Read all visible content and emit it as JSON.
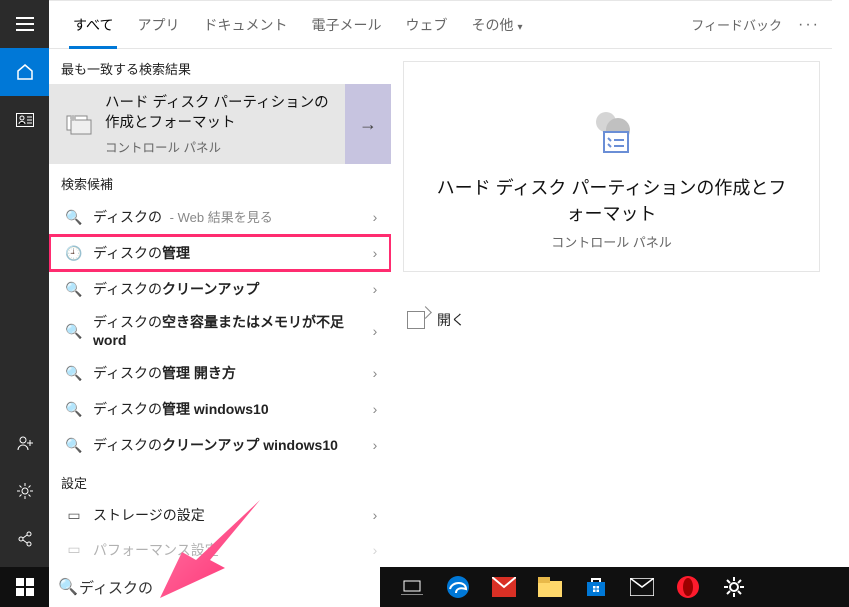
{
  "colors": {
    "accent": "#0078d7",
    "highlight": "#ff2c70"
  },
  "rail": {
    "items": [
      "menu",
      "home",
      "contacts"
    ],
    "bottom_items": [
      "person",
      "gear",
      "share"
    ]
  },
  "tabs": {
    "items": [
      {
        "label": "すべて",
        "active": true
      },
      {
        "label": "アプリ"
      },
      {
        "label": "ドキュメント"
      },
      {
        "label": "電子メール"
      },
      {
        "label": "ウェブ"
      },
      {
        "label": "その他",
        "dropdown": true
      }
    ],
    "feedback": "フィードバック"
  },
  "sections": {
    "best_match_header": "最も一致する検索結果",
    "suggestions_header": "検索候補",
    "settings_header": "設定"
  },
  "best_match": {
    "title": "ハード ディスク パーティションの作成とフォーマット",
    "subtitle": "コントロール パネル"
  },
  "suggestions": [
    {
      "icon": "search",
      "pre": "ディスクの",
      "bold": "",
      "hint": " - Web 結果を見る"
    },
    {
      "icon": "clock",
      "pre": "ディスクの",
      "bold": "管理",
      "highlight": true
    },
    {
      "icon": "search",
      "pre": "ディスクの",
      "bold": "クリーンアップ"
    },
    {
      "icon": "search",
      "pre": "ディスクの",
      "bold": "空き容量またはメモリが不足 word",
      "twoline": true
    },
    {
      "icon": "search",
      "pre": "ディスクの",
      "bold": "管理 開き方"
    },
    {
      "icon": "search",
      "pre": "ディスクの",
      "bold": "管理 windows10"
    },
    {
      "icon": "search",
      "pre": "ディスクの",
      "bold": "クリーンアップ windows10"
    }
  ],
  "settings_items": [
    {
      "icon": "drive",
      "label": "ストレージの設定"
    },
    {
      "icon": "drive",
      "label": "パフォーマンス設定"
    }
  ],
  "detail": {
    "title": "ハード ディスク パーティションの作成とフォーマット",
    "subtitle": "コントロール パネル",
    "open_label": "開く"
  },
  "search": {
    "value": "ディスクの"
  },
  "taskbar_icons": [
    "taskview",
    "edge",
    "mail-red",
    "explorer",
    "store",
    "mail",
    "opera",
    "settings"
  ]
}
